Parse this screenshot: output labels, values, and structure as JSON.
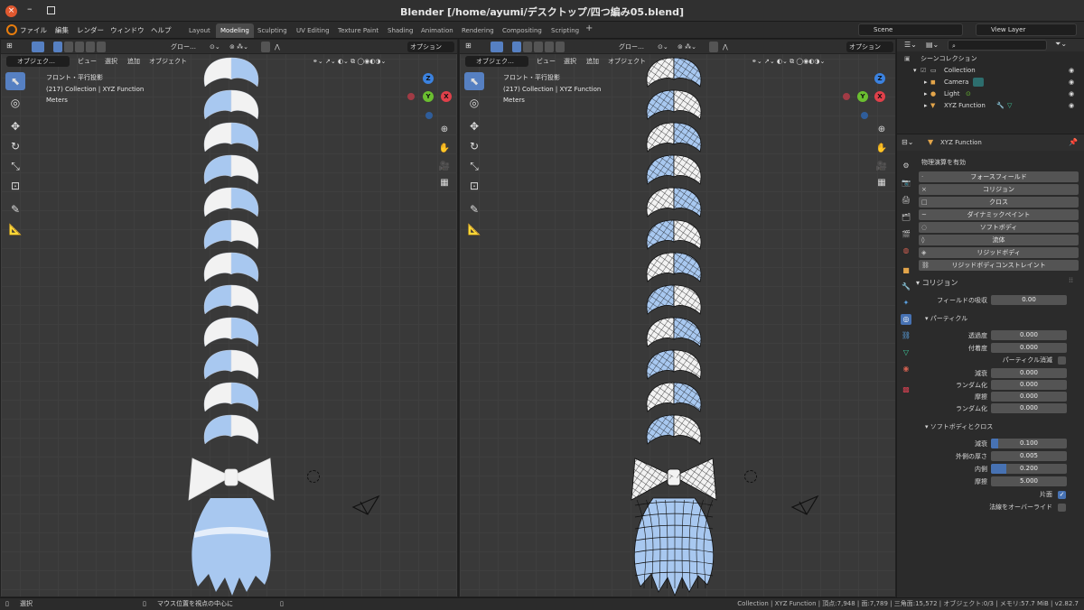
{
  "window": {
    "title": "Blender [/home/ayumi/デスクトップ/四つ編み05.blend]"
  },
  "menu": {
    "items": [
      "ファイル",
      "編集",
      "レンダー",
      "ウィンドウ",
      "ヘルプ"
    ]
  },
  "workspaces": [
    "Layout",
    "Modeling",
    "Sculpting",
    "UV Editing",
    "Texture Paint",
    "Shading",
    "Animation",
    "Rendering",
    "Compositing",
    "Scripting"
  ],
  "active_workspace": "Modeling",
  "scene": {
    "name": "Scene",
    "view_layer": "View Layer"
  },
  "viewport_left": {
    "header": {
      "mode": "オブジェク…",
      "transform": "グロー…",
      "options": "オプション"
    },
    "menu": {
      "view": "ビュー",
      "select": "選択",
      "add": "追加",
      "object": "オブジェクト"
    },
    "overlay": {
      "view_name": "フロント・平行投影",
      "collection": "(217) Collection | XYZ Function",
      "units": "Meters"
    }
  },
  "viewport_right": {
    "header": {
      "mode": "オブジェク…",
      "transform": "グロー…",
      "options": "オプション"
    },
    "menu": {
      "view": "ビュー",
      "select": "選択",
      "add": "追加",
      "object": "オブジェクト"
    },
    "overlay": {
      "view_name": "フロント・平行投影",
      "collection": "(217) Collection | XYZ Function",
      "units": "Meters"
    }
  },
  "gizmo": {
    "z": "Z",
    "y": "Y",
    "x": "X"
  },
  "outliner": {
    "root": "シーンコレクション",
    "items": [
      {
        "name": "Collection",
        "icon": "collection-icon"
      },
      {
        "name": "Camera",
        "icon": "camera-icon"
      },
      {
        "name": "Light",
        "icon": "light-icon"
      },
      {
        "name": "XYZ Function",
        "icon": "mesh-icon"
      }
    ]
  },
  "properties": {
    "object_name": "XYZ Function",
    "physics_header": "物理演算を有効",
    "physics_buttons": [
      {
        "label": "フォースフィールド",
        "icon": "·"
      },
      {
        "label": "コリジョン",
        "icon": "×"
      },
      {
        "label": "クロス",
        "icon": "□"
      },
      {
        "label": "ダイナミックペイント",
        "icon": "~"
      },
      {
        "label": "ソフトボディ",
        "icon": "◌"
      },
      {
        "label": "流体",
        "icon": "◊"
      },
      {
        "label": "リジッドボディ",
        "icon": "◈"
      },
      {
        "label": "リジッドボディコンストレイント",
        "icon": "⛓"
      }
    ],
    "collision_panel": "コリジョン",
    "field_absorption": {
      "label": "フィールドの吸収",
      "value": "0.00"
    },
    "particle_panel": "パーティクル",
    "particle_fields": [
      {
        "label": "透過度",
        "value": "0.000"
      },
      {
        "label": "付着度",
        "value": "0.000"
      }
    ],
    "particle_kill": "パーティクル消滅",
    "particle_fields2": [
      {
        "label": "減衰",
        "value": "0.000"
      },
      {
        "label": "ランダム化",
        "value": "0.000"
      },
      {
        "label": "摩擦",
        "value": "0.000"
      },
      {
        "label": "ランダム化",
        "value": "0.000"
      }
    ],
    "softbody_panel": "ソフトボディとクロス",
    "softbody_fields": [
      {
        "label": "減衰",
        "value": "0.100",
        "fill": 0.1
      },
      {
        "label": "外側の厚さ",
        "value": "0.005",
        "fill": 0
      },
      {
        "label": "内側",
        "value": "0.200",
        "fill": 0.2
      },
      {
        "label": "摩擦",
        "value": "5.000",
        "fill": 0
      }
    ],
    "single_sided": "片面",
    "override_normals": "法線をオーバーライド"
  },
  "statusbar": {
    "select": "選択",
    "center_view": "マウス位置を視点の中心に",
    "stats": "Collection | XYZ Function | 頂点:7,948 | 面:7,789 | 三角面:15,572 | オブジェクト:0/3 | メモリ:57.7 MiB | v2.82.7"
  }
}
